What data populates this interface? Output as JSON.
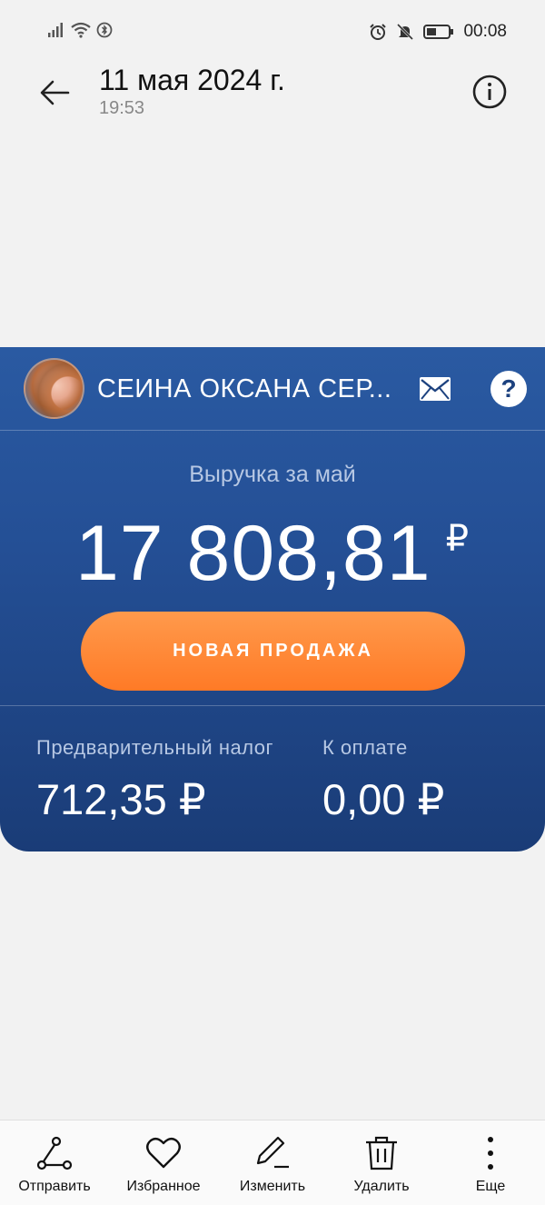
{
  "status_bar": {
    "time": "00:08"
  },
  "header": {
    "title": "11 мая 2024 г.",
    "subtitle": "19:53"
  },
  "card": {
    "user_name": "СЕИНА ОКСАНА СЕР...",
    "help_symbol": "?",
    "revenue_label": "Выручка за май",
    "revenue_value": "17 808,81",
    "currency_symbol": "₽",
    "new_sale_label": "НОВАЯ ПРОДАЖА",
    "tax_label": "Предварительный налог",
    "tax_value": "712,35 ₽",
    "pay_label": "К оплате",
    "pay_value": "0,00 ₽"
  },
  "toolbar": {
    "items": [
      {
        "label": "Отправить",
        "icon": "share-icon"
      },
      {
        "label": "Избранное",
        "icon": "heart-icon"
      },
      {
        "label": "Изменить",
        "icon": "edit-icon"
      },
      {
        "label": "Удалить",
        "icon": "trash-icon"
      },
      {
        "label": "Еще",
        "icon": "more-vertical-icon"
      }
    ]
  },
  "colors": {
    "card_top": "#2a5aa2",
    "card_bottom": "#1a3c77",
    "button_orange": "#ff7a26"
  }
}
